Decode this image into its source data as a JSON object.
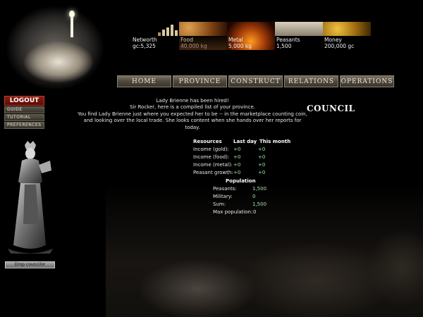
{
  "stats": [
    {
      "label": "Networth",
      "value": "gc:5,325"
    },
    {
      "label": "Food",
      "value": "40,000 kg"
    },
    {
      "label": "Metal",
      "value": "5,000 kg"
    },
    {
      "label": "Peasants",
      "value": "1,500"
    },
    {
      "label": "Money",
      "value": "200,000 gc"
    }
  ],
  "nav": [
    {
      "label": "HOME"
    },
    {
      "label": "PROVINCE"
    },
    {
      "label": "CONSTRUCT"
    },
    {
      "label": "RELATIONS"
    },
    {
      "label": "OPERATIONS"
    }
  ],
  "side_menu": {
    "logout": "LOGOUT",
    "items": [
      "GUIDE",
      "TUTORIAL",
      "PREFERENCES"
    ]
  },
  "drop_button": "Drop councilor",
  "message": {
    "line1": "Lady Brienne has been hired!",
    "line2": "Sir Rocker, here is a compiled list of your province.",
    "line3": "You find Lady Brienne just where you expected her to be -- in the marketplace counting coin,",
    "line4": "and looking over the local trade. She looks content when she hands over her reports for today."
  },
  "council_title": "COUNCIL",
  "resources": {
    "headers": [
      "Resources",
      "Last day",
      "This month"
    ],
    "rows": [
      [
        "Income (gold):",
        "+0",
        "+0"
      ],
      [
        "Income (food):",
        "+0",
        "+0"
      ],
      [
        "Income (metal):",
        "+0",
        "+0"
      ],
      [
        "Peasant growth:",
        "+0",
        "+0"
      ]
    ]
  },
  "population": {
    "title": "Population",
    "rows": [
      [
        "Peasants:",
        "1,500"
      ],
      [
        "Military:",
        "0"
      ],
      [
        "Sum:",
        "1,500"
      ],
      [
        "Max population:",
        "0"
      ]
    ]
  },
  "colors": {
    "background": "#000000",
    "value_green": "#9ee6a0",
    "logout_red": "#8a1c12"
  }
}
